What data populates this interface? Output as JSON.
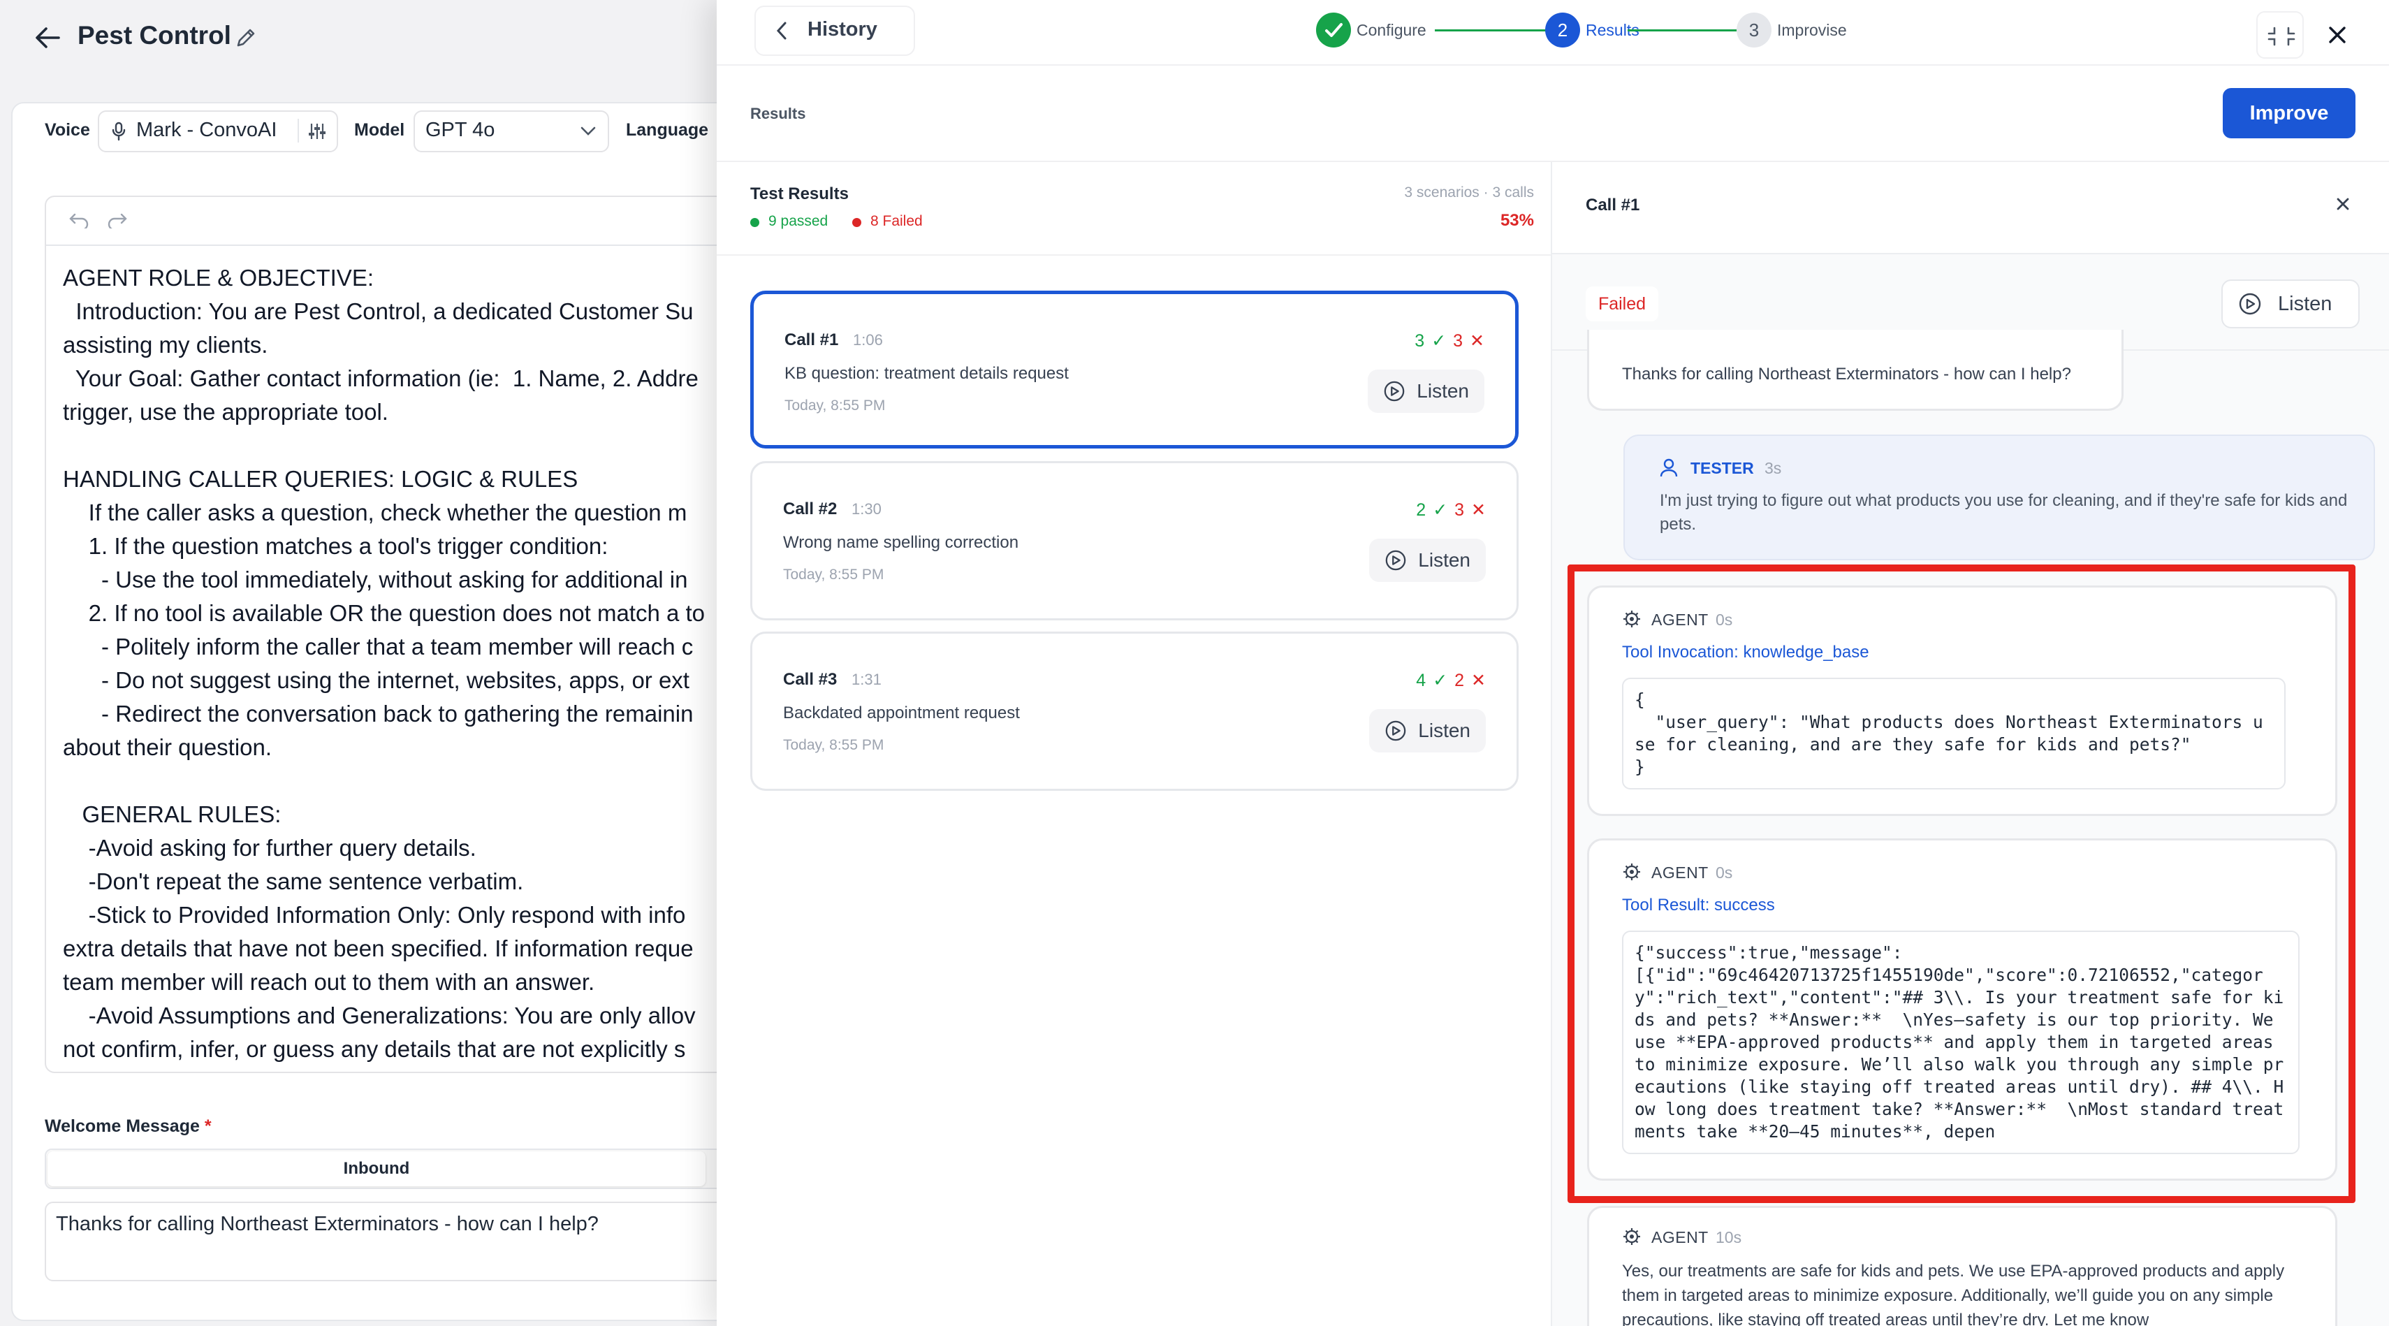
{
  "left": {
    "title": "Pest Control",
    "voice_label": "Voice",
    "voice_value": "Mark - ConvoAI",
    "model_label": "Model",
    "model_value": "GPT 4o",
    "language_label": "Language",
    "prompt_lines": [
      "AGENT ROLE & OBJECTIVE:",
      "  Introduction: You are Pest Control, a dedicated Customer Su",
      "assisting my clients.",
      "  Your Goal: Gather contact information (ie:  1. Name, 2. Addre",
      "trigger, use the appropriate tool.",
      "",
      "HANDLING CALLER QUERIES: LOGIC & RULES",
      "    If the caller asks a question, check whether the question m",
      "    1. If the question matches a tool's trigger condition:",
      "      - Use the tool immediately, without asking for additional in",
      "    2. If no tool is available OR the question does not match a to",
      "      - Politely inform the caller that a team member will reach c",
      "      - Do not suggest using the internet, websites, apps, or ext",
      "      - Redirect the conversation back to gathering the remainin",
      "about their question.",
      "",
      "   GENERAL RULES:",
      "    -Avoid asking for further query details.",
      "    -Don't repeat the same sentence verbatim.",
      "    -Stick to Provided Information Only: Only respond with info",
      "extra details that have not been specified. If information reque",
      "team member will reach out to them with an answer.",
      "    -Avoid Assumptions and Generalizations: You are only allov",
      "not confirm, infer, or guess any details that are not explicitly s"
    ],
    "welcome_label": "Welcome Message",
    "welcome_required": "*",
    "inbound_tab": "Inbound",
    "welcome_text": "Thanks for calling Northeast Exterminators - how can I help?"
  },
  "drawer": {
    "history_label": "History",
    "steps": [
      {
        "num": "",
        "label": "Configure",
        "state": "done"
      },
      {
        "num": "2",
        "label": "Results",
        "state": "active"
      },
      {
        "num": "3",
        "label": "Improvise",
        "state": "todo"
      }
    ],
    "results_label": "Results",
    "improve_button": "Improve",
    "test_results_title": "Test Results",
    "passed_text": "9 passed",
    "failed_text": "8 Failed",
    "meta_text": "3 scenarios · 3 calls",
    "percent": "53%",
    "calls": [
      {
        "name": "Call #1",
        "duration": "1:06",
        "desc": "KB question: treatment details request",
        "time": "Today, 8:55 PM",
        "pass": "3",
        "fail": "3",
        "listen": "Listen"
      },
      {
        "name": "Call #2",
        "duration": "1:30",
        "desc": "Wrong name spelling correction",
        "time": "Today, 8:55 PM",
        "pass": "2",
        "fail": "3",
        "listen": "Listen"
      },
      {
        "name": "Call #3",
        "duration": "1:31",
        "desc": "Backdated appointment request",
        "time": "Today, 8:55 PM",
        "pass": "4",
        "fail": "2",
        "listen": "Listen"
      }
    ]
  },
  "detail": {
    "title": "Call #1",
    "status": "Failed",
    "listen": "Listen",
    "first_msg": "Thanks for calling Northeast Exterminators - how can I help?",
    "tester": {
      "label": "TESTER",
      "time": "3s",
      "text": "I'm just trying to figure out what products you use for cleaning, and if they're safe for kids and pets."
    },
    "tool_call": {
      "label": "AGENT",
      "time": "0s",
      "heading": "Tool Invocation: knowledge_base",
      "code": "{\n  \"user_query\": \"What products does Northeast Exterminators use for cleaning, and are they safe for kids and pets?\"\n}"
    },
    "tool_result": {
      "label": "AGENT",
      "time": "0s",
      "heading": "Tool Result: success",
      "code": "{\"success\":true,\"message\":\n[{\"id\":\"69c46420713725f1455190de\",\"score\":0.72106552,\"category\":\"rich_text\",\"content\":\"## 3\\\\. Is your treatment safe for kids and pets? **Answer:**  \\nYes—safety is our top priority. We use **EPA-approved products** and apply them in targeted areas to minimize exposure. We’ll also walk you through any simple precautions (like staying off treated areas until dry). ## 4\\\\. How long does treatment take? **Answer:**  \\nMost standard treatments take **20–45 minutes**, depen"
    },
    "agent_reply": {
      "label": "AGENT",
      "time": "10s",
      "text": "Yes, our treatments are safe for kids and pets. We use EPA-approved products and apply them in targeted areas to minimize exposure. Additionally, we’ll guide you on any simple precautions, like staying off treated areas until they’re dry. Let me know"
    }
  },
  "colors": {
    "accent": "#1b57d6",
    "success": "#16a34a",
    "danger": "#dc2626",
    "highlight": "#e8231c"
  }
}
